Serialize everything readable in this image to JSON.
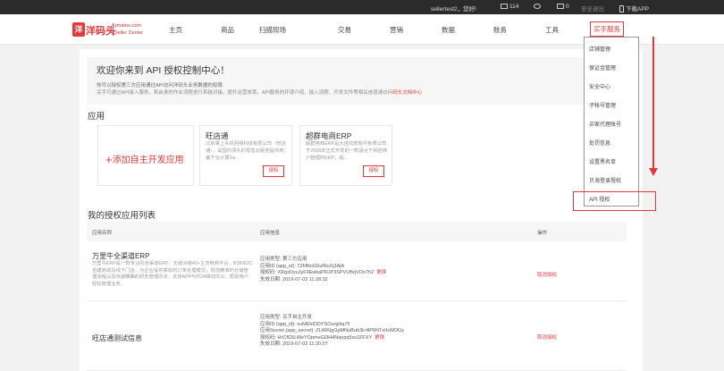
{
  "topbar": {
    "greeting": "sellertest2，您好!",
    "messages_count": "114",
    "notif_count": "0",
    "safety": "安全退出",
    "download_app": "下载APP"
  },
  "logo": {
    "mark": "洋",
    "text": "洋码头",
    "domain": "ymatou.com",
    "sub": "Seller Center"
  },
  "nav": {
    "items": [
      "主页",
      "商品",
      "扫描现场",
      "交易",
      "营销",
      "数据",
      "账务",
      "工具"
    ],
    "active": "买手服务"
  },
  "welcome": {
    "title": "欢迎你来到 API 授权控制中心！",
    "line1": "你可以授权第三方应用通过API访问洋码头业务数据的权限",
    "line2": "买手可通过API接入服务，和自身的作业流程进行系统对接，提升运营效率。API服务的环境介绍、接入流程、开发文件等相关信息请访问",
    "link": "码头文档中心"
  },
  "sections": {
    "apps": "应用",
    "authorized": "我的授权应用列表"
  },
  "cards": {
    "add": "添加自主开发应用",
    "add_plus": "+",
    "items": [
      {
        "name": "旺店通",
        "desc": "北京掌上先机网络科技有限公司（旺店通），是国内领先的零售云服务提供商，基于云计算Sa...",
        "btn": "授权"
      },
      {
        "name": "超群电商ERP",
        "desc": "超群电商ERP是大连炫皮软件有限公司于2008年正式开发的一款适合于网店商户管理的ERP。超...",
        "btn": "授权"
      }
    ]
  },
  "table": {
    "headers": [
      "应用名称",
      "应用信息",
      "操作"
    ],
    "rows": [
      {
        "name": "万里牛全渠道ERP",
        "desc": "万里牛ERP是一款专业的全渠道ERP，无缝对接40+主流电商平台，B2B/B2C自建商城及线下门店，为企业提供高效的订单处理模式，规范精准的仓储管理流程以及快速精确的财务管理办法，支持APP与PDA移动办公，帮助用户轻松管理业务。",
        "info": [
          "应用类型:    第三方应用",
          "应用ID (app_id):    7ZhBtoG5uNluXj3AjA",
          "授权码:    XRgzDyuJyF9EwkaPRJP3SPVUBqVOo7h2",
          "失效日期:    2019-07-03 11:28:32"
        ],
        "change": "更换",
        "op": "取消授权"
      },
      {
        "name": "旺店通测试信息",
        "desc": "",
        "info": [
          "应用类型:    买手自主开发",
          "应用ID (app_id):    vuMEbIDDYSOurgHq7F",
          "应用Secret (app_secret):    ZLtRKlgGpMNuBub3lc4lP6NTxIIsWDGy",
          "授权码:    HrCfG5LWeYOpmeGl3H4Nqepq5xs3ZFXY",
          "失效日期:    2019-07-03 11:20:07"
        ],
        "change": "更换",
        "op": "取消授权"
      }
    ]
  },
  "dropdown": {
    "items": [
      "店铺管理",
      "保证金管理",
      "安全中心",
      "子帐号管理",
      "买家代理账号",
      "处罚信息",
      "设置黑名单",
      "贝海登录授权",
      "API 授权"
    ]
  },
  "colors": {
    "accent": "#e4393c",
    "topbar": "#2b2b2b"
  }
}
